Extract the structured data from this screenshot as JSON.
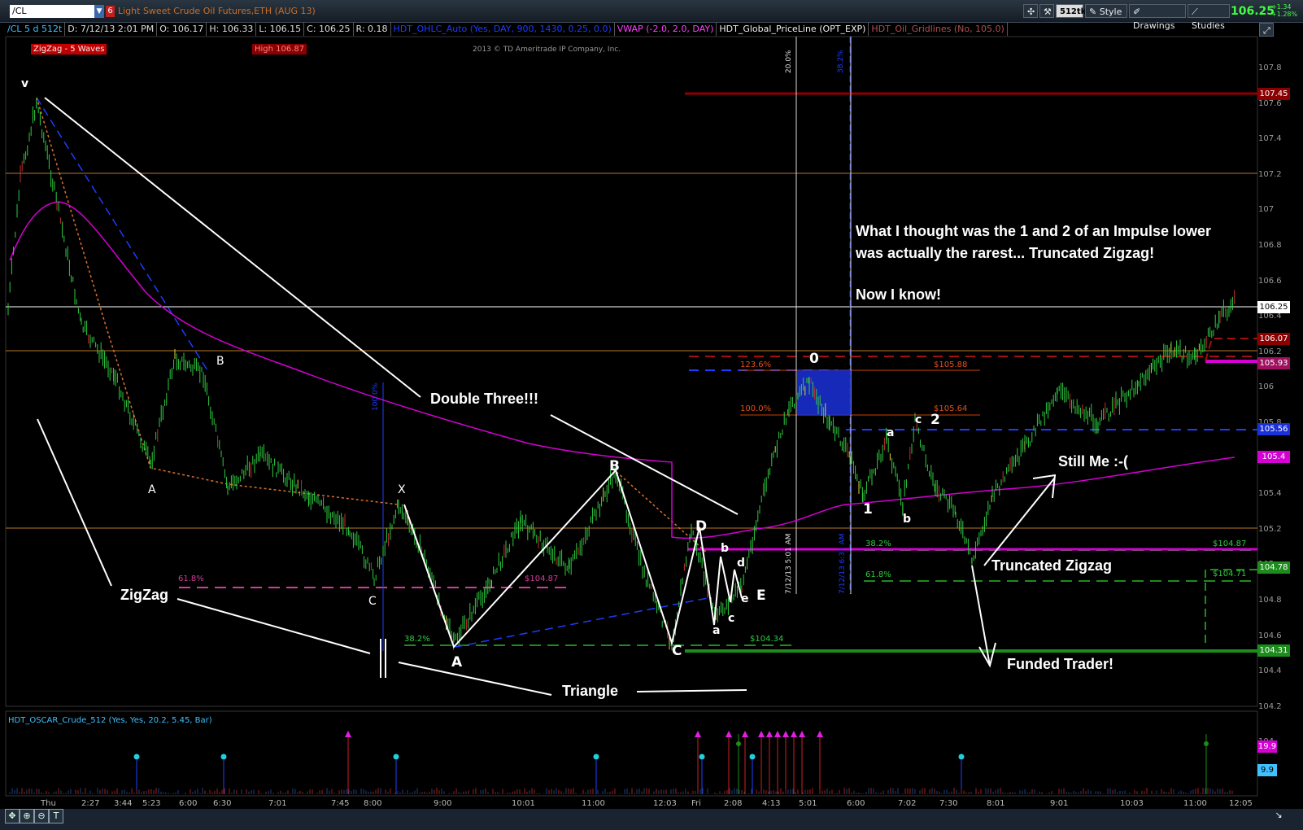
{
  "header": {
    "symbol": "/CL",
    "group_number": "6",
    "description": "Light Sweet Crude Oil Futures,ETH (AUG 13)",
    "tick_label": "512tk",
    "style_label": "Style",
    "drawings_label": "Drawings",
    "studies_label": "Studies",
    "last_price": "106.25",
    "change": "+1.34",
    "change_pct": "+1.28%"
  },
  "infobar": {
    "chart_id": "/CL 5 d 512t",
    "date": "D: 7/12/13 2:01 PM",
    "open": "O: 106.17",
    "high": "H: 106.33",
    "low": "L: 106.15",
    "close": "C: 106.25",
    "range": "R: 0.18",
    "study1": "HDT_OHLC_Auto (Yes, DAY, 900, 1430, 0.25, 0.0)",
    "study2": "VWAP (-2.0, 2.0, DAY)",
    "study3": "HDT_Global_PriceLine (OPT_EXP)",
    "study4": "HDT_Oil_Gridlines (No, 105.0)"
  },
  "chart": {
    "zigzag_badge": "ZigZag - 5 Waves",
    "high_badge": "High 106.87",
    "copyright": "2013 © TD Ameritrade IP Company, Inc.",
    "colors": {
      "price_up": "#2ecc40",
      "vwap": "#d400d4",
      "support": "#1c8c1c",
      "resistance": "#8c0000",
      "blue": "#1e3cff",
      "annotation": "#ffffff"
    }
  },
  "annotations": {
    "double_three": "Double Three!!!",
    "zigzag": "ZigZag",
    "triangle": "Triangle",
    "truncated_zigzag": "Truncated Zigzag",
    "still_me": "Still Me :-(",
    "funded_trader": "Funded Trader!",
    "thought_line1": "What I thought was the 1 and 2 of an Impulse lower",
    "thought_line2": "was actually the rarest... Truncated Zigzag!",
    "now_i_know": "Now I know!"
  },
  "wave_labels": {
    "v": "v",
    "A1": "A",
    "B1": "B",
    "C1": "C",
    "X": "X",
    "A2": "A",
    "B2": "B",
    "C2": "C",
    "D": "D",
    "E": "E",
    "a1": "a",
    "b1": "b",
    "c1": "c",
    "d1": "d",
    "e1": "e",
    "zero": "0",
    "one": "1",
    "two": "2",
    "a2": "a",
    "b2": "b",
    "c2": "c"
  },
  "fib_labels": {
    "f61": "61.8%",
    "f61_price": "$104.87",
    "f38_left": "38.2%",
    "f38_left_price": "$104.34",
    "f123": "123.6%",
    "f123_price": "$105.88",
    "f100": "100.0%",
    "f100_price": "$105.64",
    "f38_right": "38.2%",
    "f38_right_price": "$104.87",
    "f61_right": "61.8%",
    "f61_right_price": "$104.71",
    "v20": "20.0%",
    "v38": "38.2%",
    "v100": "100.0%",
    "time1": "7/12/13 5:01 AM",
    "time2": "7/12/13 6:31 AM"
  },
  "price_axis": {
    "ticks": [
      "107.8",
      "107.6",
      "107.4",
      "107.2",
      "107",
      "106.8",
      "106.6",
      "106.4",
      "106.2",
      "106",
      "105.8",
      "105.6",
      "105.4",
      "105.2",
      "105",
      "104.8",
      "104.6",
      "104.4",
      "104.2",
      "104"
    ],
    "markers": {
      "m10745": "107.45",
      "m10625": "106.25",
      "m10607": "106.07",
      "m10593": "105.93",
      "m10556": "105.56",
      "m1054": "105.4",
      "m10478": "104.78",
      "m10431": "104.31"
    }
  },
  "oscillator": {
    "title": "HDT_OSCAR_Crude_512 (Yes, Yes, 20.2, 5.45, Bar)",
    "marker_high": "19.9",
    "marker_low": "9.9"
  },
  "time_axis": [
    "Thu",
    "2:27",
    "3:44",
    "5:23",
    "6:00",
    "6:30",
    "7:01",
    "7:45",
    "8:00",
    "9:00",
    "10:01",
    "11:00",
    "12:03",
    "Fri",
    "2:08",
    "4:13",
    "5:01",
    "6:00",
    "7:02",
    "7:30",
    "8:01",
    "9:01",
    "10:03",
    "11:00",
    "12:05"
  ]
}
